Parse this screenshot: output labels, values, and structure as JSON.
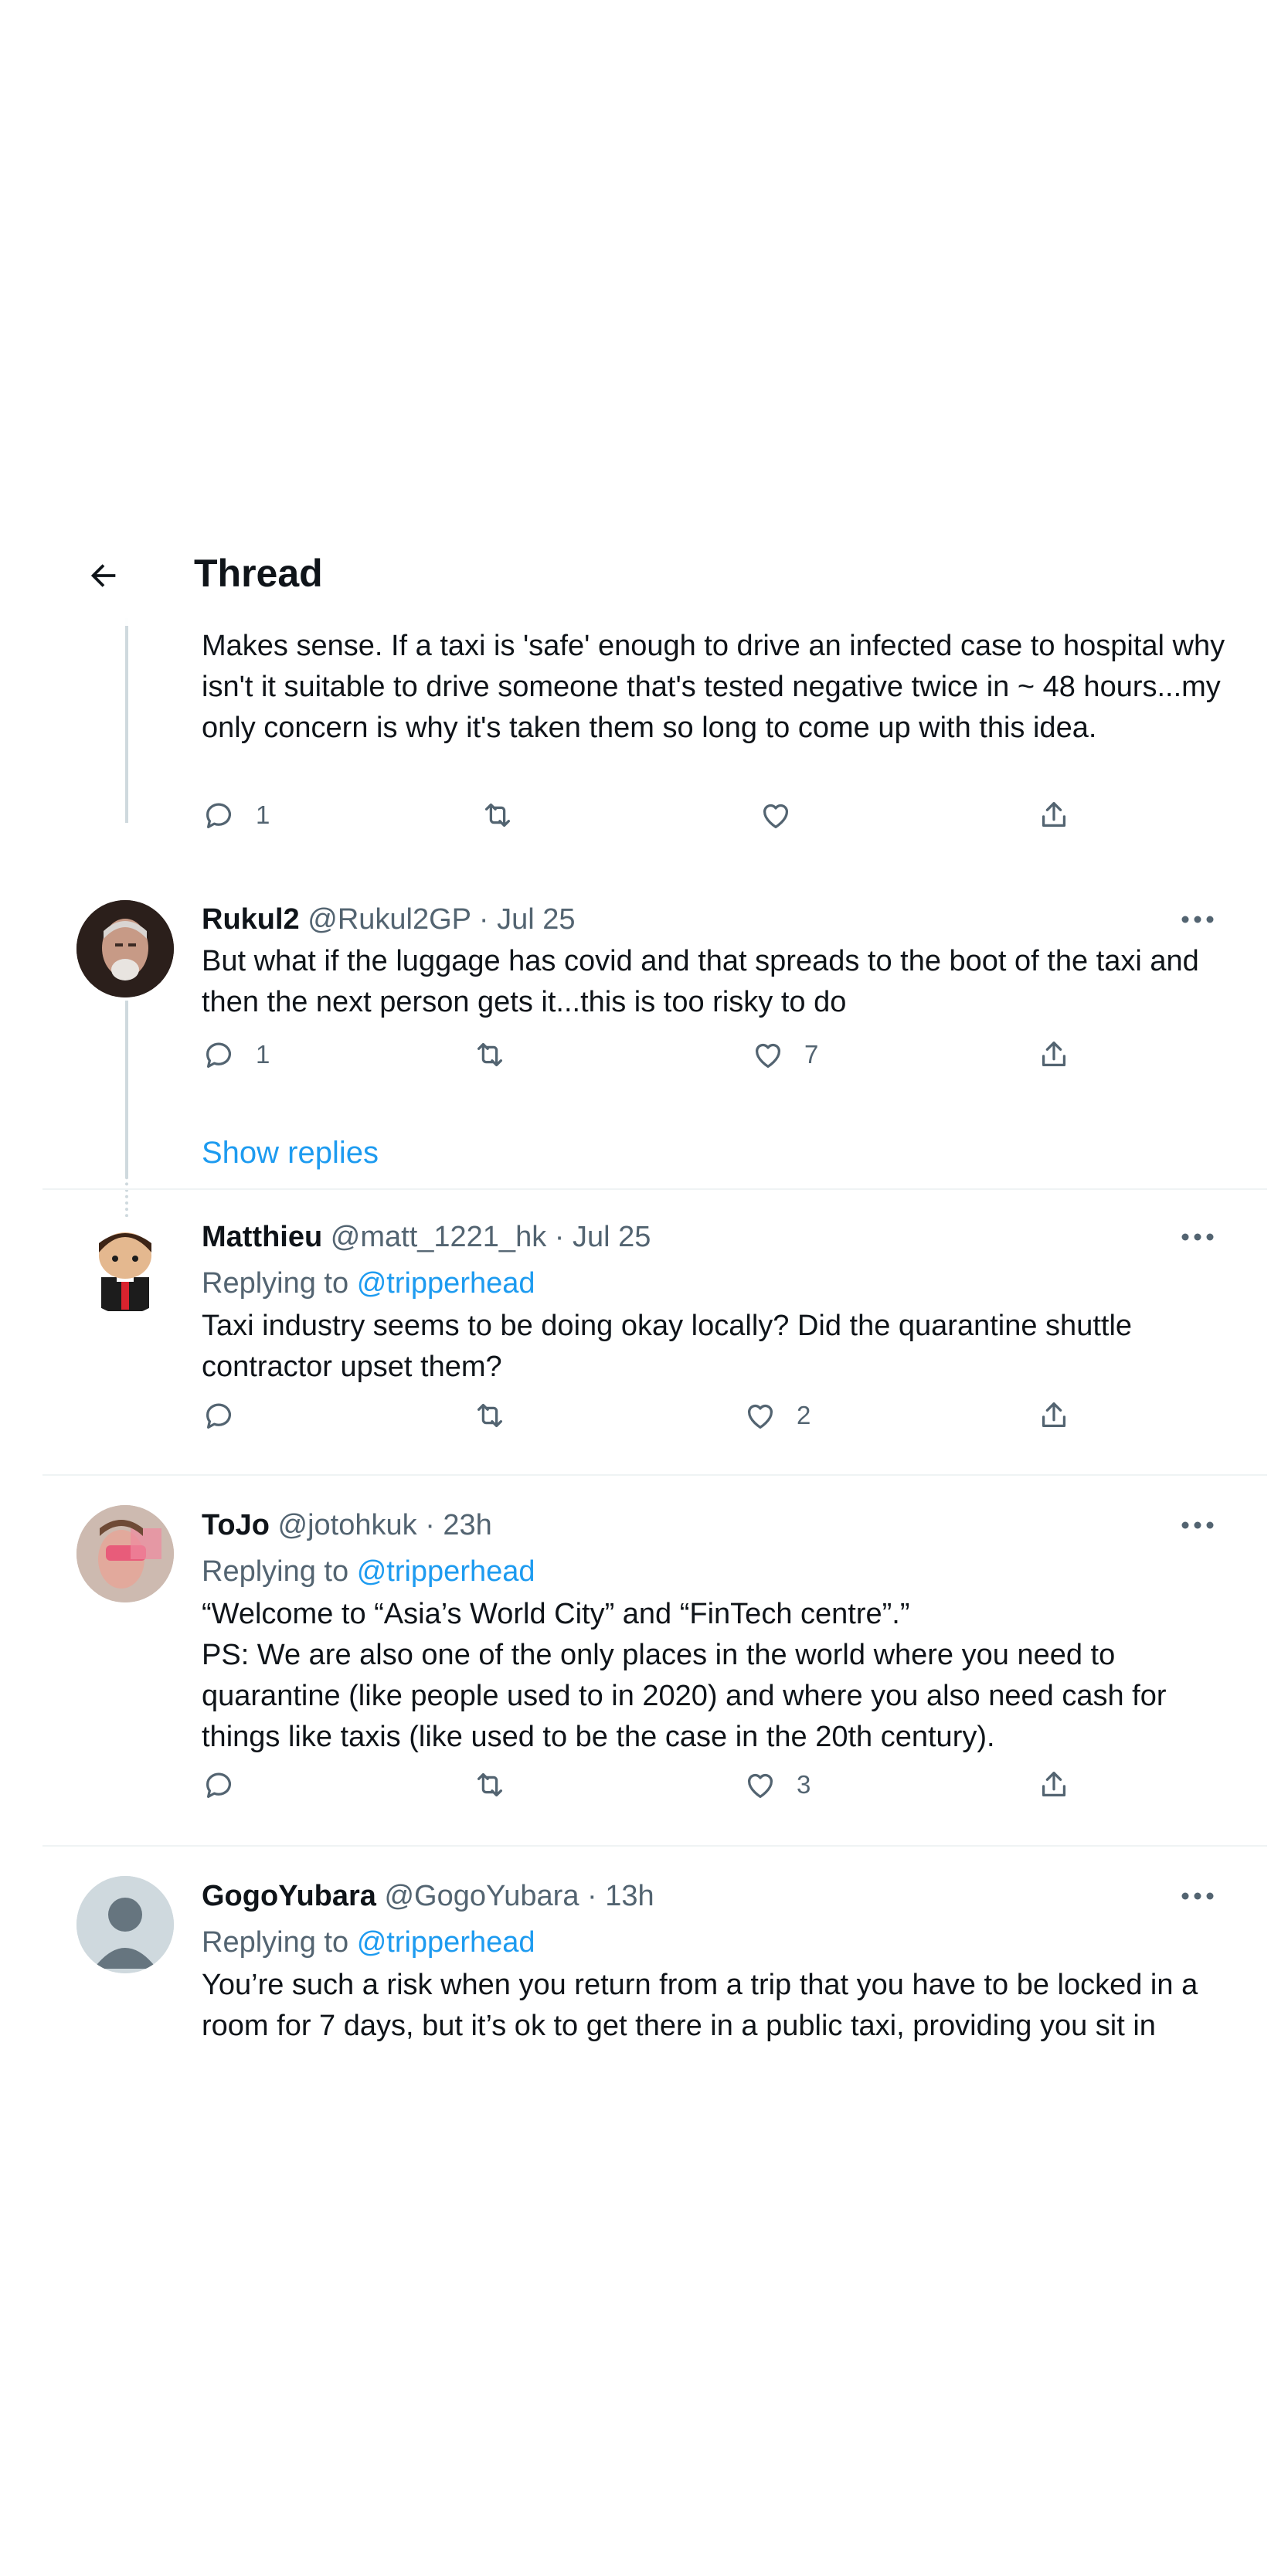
{
  "header": {
    "title": "Thread"
  },
  "tweets": [
    {
      "body": "Makes sense. If a taxi is 'safe' enough to drive an infected case to hospital why isn't it suitable to drive someone that's tested negative twice in ~ 48 hours...my only concern is why it's taken them so long to come up with this idea.",
      "replies": "1",
      "retweets": "",
      "likes": ""
    },
    {
      "name": "Rukul2",
      "handle": "@Rukul2GP",
      "time": "· Jul 25",
      "body": "But what if the luggage has covid and that spreads to the boot of the taxi and then the next person gets it...this is too risky to do",
      "replies": "1",
      "retweets": "",
      "likes": "7"
    },
    {
      "name": "Matthieu",
      "handle": "@matt_1221_hk",
      "time": "· Jul 25",
      "replying_prefix": "Replying to",
      "replying_to": "@tripperhead",
      "body": "Taxi industry seems to be doing okay locally? Did the quarantine shuttle contractor upset them?",
      "replies": "",
      "retweets": "",
      "likes": "2"
    },
    {
      "name": "ToJo",
      "handle": "@jotohkuk",
      "time": "· 23h",
      "replying_prefix": "Replying to",
      "replying_to": "@tripperhead",
      "body_line1": "“Welcome to “Asia’s World City” and “FinTech centre”.”",
      "body_line2": "PS: We are also one of the only places in the world where you need to quarantine (like people used to in 2020) and where you also need cash for things like taxis (like used to be the case in the 20th century).",
      "replies": "",
      "retweets": "",
      "likes": "3"
    },
    {
      "name": "GogoYubara",
      "handle": "@GogoYubara",
      "time": "· 13h",
      "replying_prefix": "Replying to",
      "replying_to": "@tripperhead",
      "body": "You’re such a risk when you return from a trip that you have to be locked in a room for 7 days, but it’s ok to get there in a public taxi, providing you sit in"
    }
  ],
  "show_replies_label": "Show replies",
  "colors": {
    "accent": "#1d9bf0",
    "muted": "#536471",
    "text": "#0f1419",
    "line": "#cfd9de"
  }
}
